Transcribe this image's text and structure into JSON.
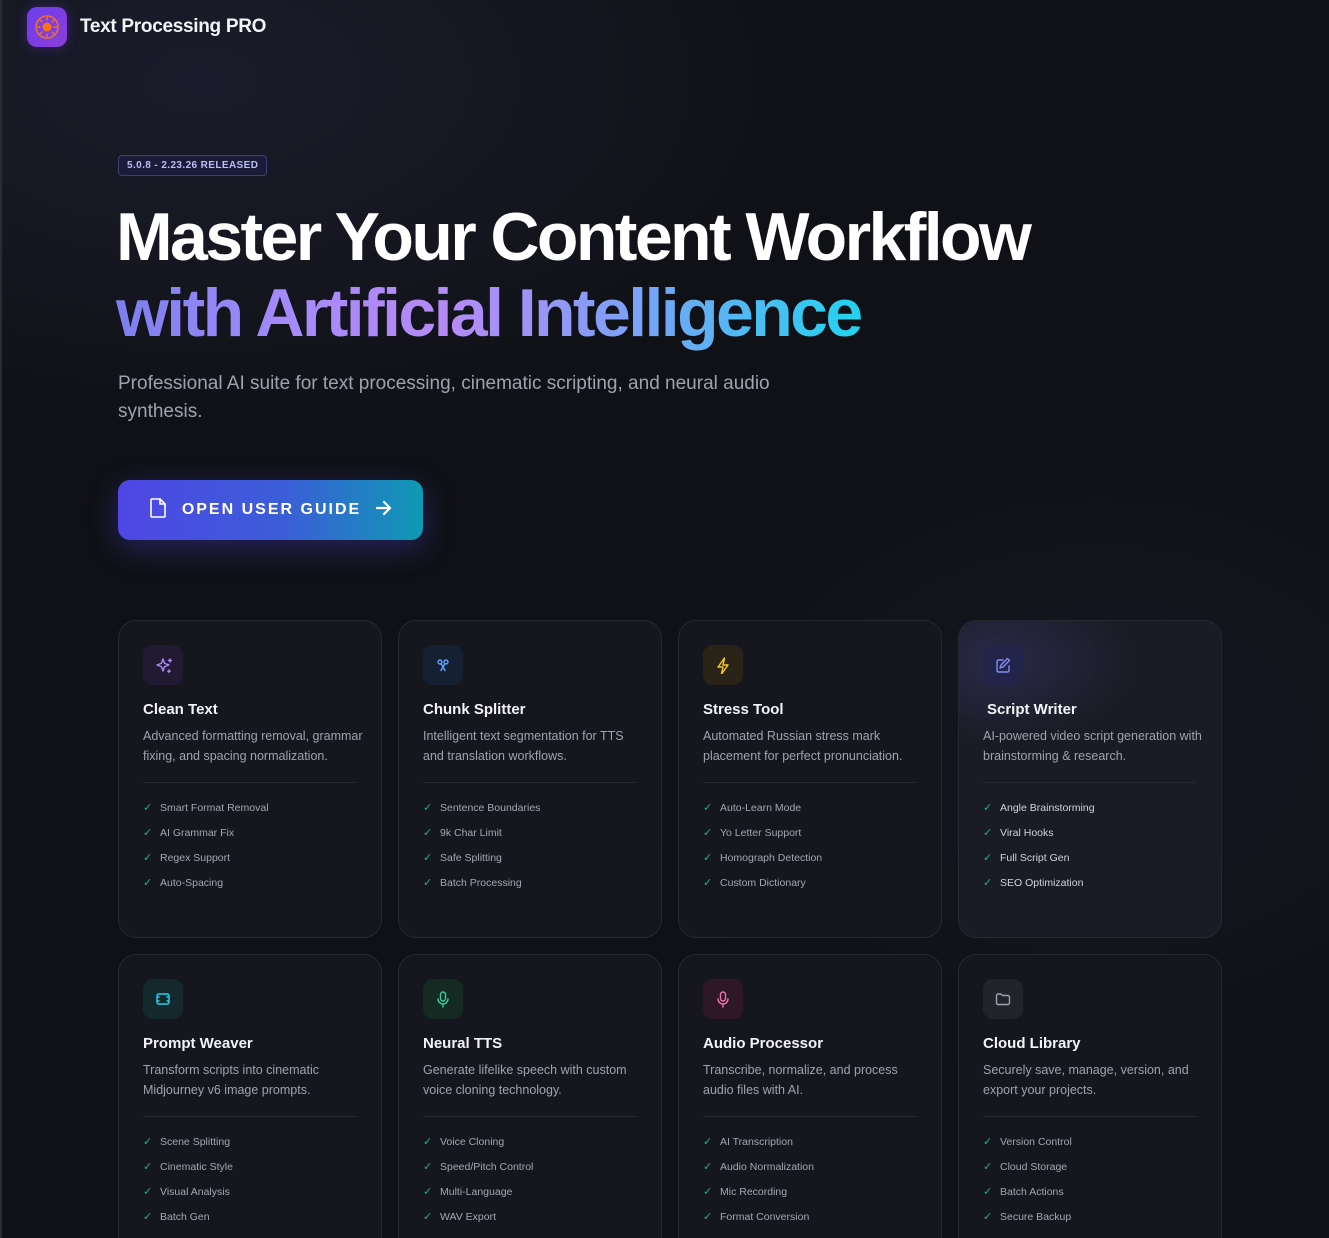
{
  "app": {
    "title": "Text Processing PRO"
  },
  "hero": {
    "badge": "5.0.8 - 2.23.26 RELEASED",
    "headline_line1": "Master Your Content Workflow",
    "headline_line2": "with Artificial Intelligence",
    "subtitle": "Professional AI suite for text processing, cinematic scripting, and neural audio synthesis.",
    "cta_label": "OPEN USER GUIDE"
  },
  "colors": {
    "accent": "#4f46e5",
    "check": "#10b981"
  },
  "cards": [
    {
      "title": "Clean Text",
      "icon": "sparkles-icon",
      "icon_color": "#a78bfa",
      "icon_bg": "#221a33",
      "desc": "Advanced formatting removal, grammar fixing, and spacing normalization.",
      "features": [
        "Smart Format Removal",
        "AI Grammar Fix",
        "Regex Support",
        "Auto-Spacing"
      ]
    },
    {
      "title": "Chunk Splitter",
      "icon": "scissors-icon",
      "icon_color": "#60a5fa",
      "icon_bg": "#162033",
      "desc": "Intelligent text segmentation for TTS and translation workflows.",
      "features": [
        "Sentence Boundaries",
        "9k Char Limit",
        "Safe Splitting",
        "Batch Processing"
      ]
    },
    {
      "title": "Stress Tool",
      "icon": "lightning-icon",
      "icon_color": "#facc15",
      "icon_bg": "#2a2418",
      "desc": "Automated Russian stress mark placement for perfect pronunciation.",
      "features": [
        "Auto-Learn Mode",
        "Yo Letter Support",
        "Homograph Detection",
        "Custom Dictionary"
      ]
    },
    {
      "title": "Script Writer",
      "icon": "pencil-square-icon",
      "icon_color": "#818cf8",
      "icon_bg": "#23244a",
      "desc": "AI-powered video script generation with brainstorming & research.",
      "features": [
        "Angle Brainstorming",
        "Viral Hooks",
        "Full Script Gen",
        "SEO Optimization"
      ]
    },
    {
      "title": "Prompt Weaver",
      "icon": "film-icon",
      "icon_color": "#22d3ee",
      "icon_bg": "#13292e",
      "desc": "Transform scripts into cinematic Midjourney v6 image prompts.",
      "features": [
        "Scene Splitting",
        "Cinematic Style",
        "Visual Analysis",
        "Batch Gen"
      ]
    },
    {
      "title": "Neural TTS",
      "icon": "microphone-icon",
      "icon_color": "#34d399",
      "icon_bg": "#142a22",
      "desc": "Generate lifelike speech with custom voice cloning technology.",
      "features": [
        "Voice Cloning",
        "Speed/Pitch Control",
        "Multi-Language",
        "WAV Export"
      ]
    },
    {
      "title": "Audio Processor",
      "icon": "microphone-icon",
      "icon_color": "#f472b6",
      "icon_bg": "#2e1826",
      "desc": "Transcribe, normalize, and process audio files with AI.",
      "features": [
        "AI Transcription",
        "Audio Normalization",
        "Mic Recording",
        "Format Conversion"
      ]
    },
    {
      "title": "Cloud Library",
      "icon": "folder-icon",
      "icon_color": "#9ca3af",
      "icon_bg": "#23242b",
      "desc": "Securely save, manage, version, and export your projects.",
      "features": [
        "Version Control",
        "Cloud Storage",
        "Batch Actions",
        "Secure Backup"
      ]
    }
  ]
}
